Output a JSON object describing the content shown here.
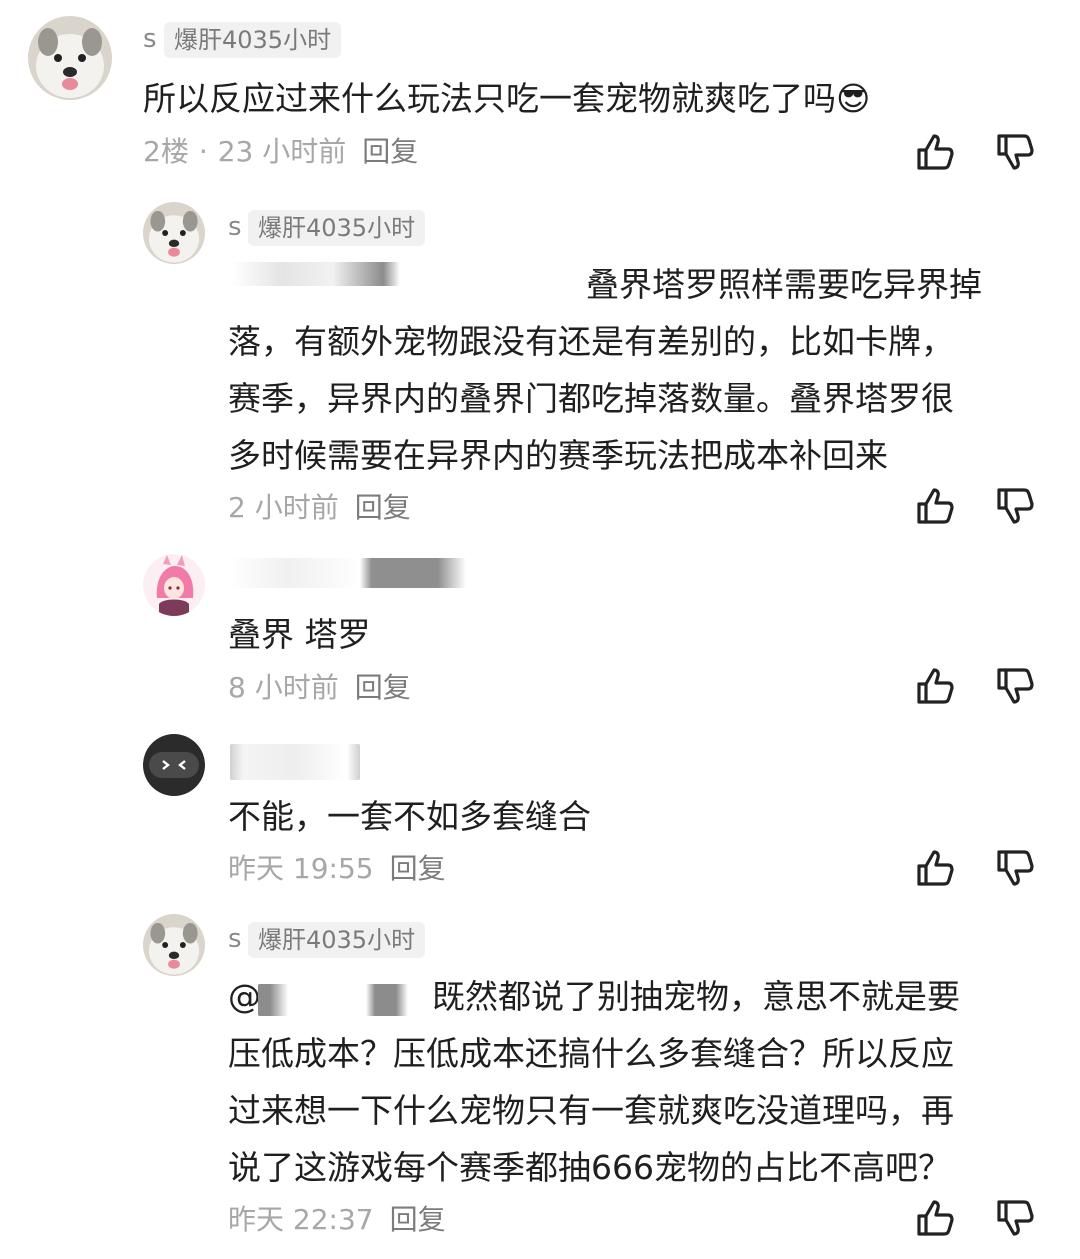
{
  "comments": [
    {
      "username": "s",
      "badge": "爆肝4035小时",
      "lines": [
        "所以反应过来什么玩法只吃一套宠物就爽吃了吗😎"
      ],
      "floor": "2楼",
      "time": "23 小时前",
      "reply_label": "回复",
      "avatar": "husky-dog-avatar"
    },
    {
      "username": "s",
      "badge": "爆肝4035小时",
      "lines": [
        "叠界塔罗照样需要吃异界掉",
        "落，有额外宠物跟没有还是有差别的，比如卡牌，",
        "赛季，异界内的叠界门都吃掉落数量。叠界塔罗很",
        "多时候需要在异界内的赛季玩法把成本补回来"
      ],
      "time": "2 小时前",
      "reply_label": "回复",
      "avatar": "husky-dog-avatar"
    },
    {
      "username": "",
      "lines": [
        "叠界 塔罗"
      ],
      "time": "8 小时前",
      "reply_label": "回复",
      "avatar": "pink-anime-avatar"
    },
    {
      "username": "",
      "lines": [
        "不能，一套不如多套缝合"
      ],
      "time": "昨天 19:55",
      "reply_label": "回复",
      "avatar": "dark-face-avatar"
    },
    {
      "username": "s",
      "badge": "爆肝4035小时",
      "lines": [
        "既然都说了别抽宠物，意思不就是要",
        "压低成本？压低成本还搞什么多套缝合？所以反应",
        "过来想一下什么宠物只有一套就爽吃没道理吗，再",
        "说了这游戏每个赛季都抽666宠物的占比不高吧？"
      ],
      "mention_prefix": "@",
      "time": "昨天 22:37",
      "reply_label": "回复",
      "avatar": "husky-dog-avatar"
    }
  ],
  "icons": {
    "like": "thumbs-up-icon",
    "dislike": "thumbs-down-icon"
  },
  "colors": {
    "text": "#1f1f1f",
    "meta": "#a7a7a7",
    "badge_bg": "#f1f1f1"
  }
}
